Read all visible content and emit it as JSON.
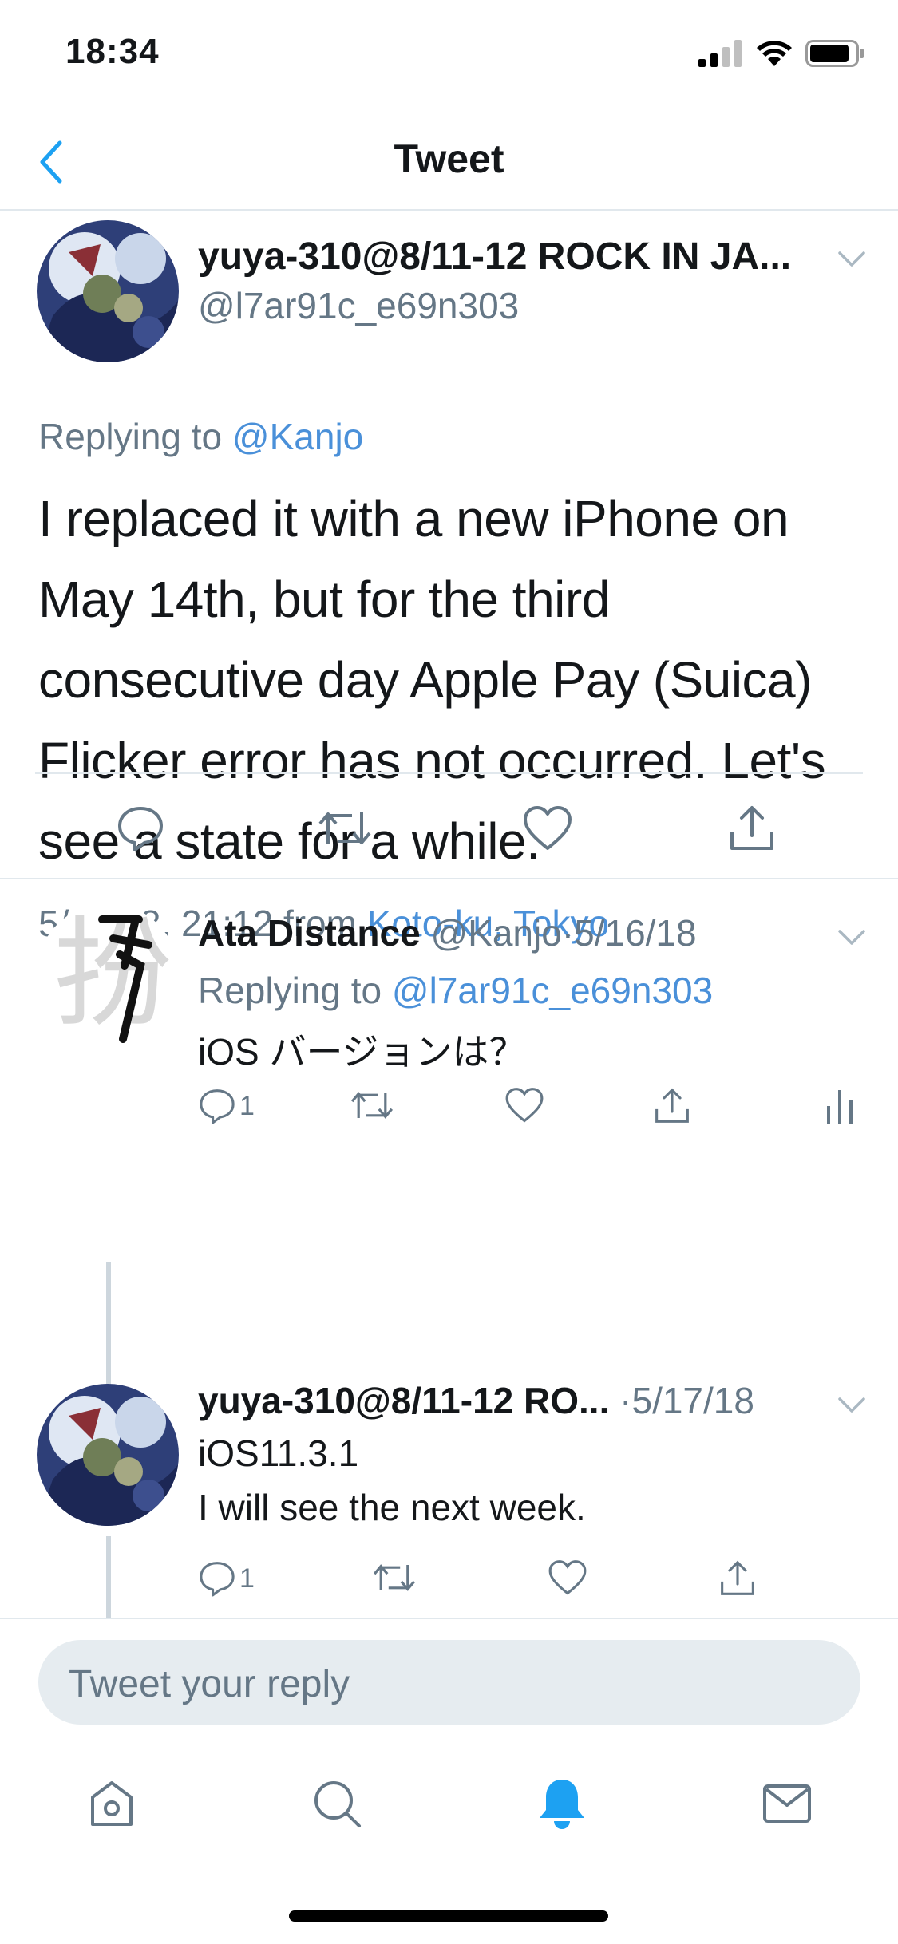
{
  "status_bar": {
    "time": "18:34"
  },
  "nav": {
    "title": "Tweet"
  },
  "main_tweet": {
    "name": "yuya-310@8/11-12 ROCK IN JA...",
    "handle": "@l7ar91c_e69n303",
    "replying_prefix": "Replying to",
    "replying_handle": "@Kanjo",
    "text_lines": [
      "I replaced it with a new iPhone on",
      "May 14th, but for the third",
      "consecutive day Apple Pay (Suica)",
      "Flicker error has not occurred. Let's",
      "see a state for a while."
    ],
    "datetime": "5/16/18, 21:12",
    "from_prefix": "from",
    "location": "Koto-ku, Tokyo"
  },
  "replies": [
    {
      "name": "Ata Distance",
      "handle": "@Kanjo",
      "separator": "·",
      "date": "5/16/18",
      "replying_prefix": "Replying to",
      "replying_handle": "@l7ar91c_e69n303",
      "text_lines": [
        "iOS バージョンは？"
      ],
      "reply_count": "1"
    },
    {
      "name": "yuya-310@8/11-12 RO...",
      "separator": "·",
      "date": "5/17/18",
      "text_lines": [
        "iOS11.3.1",
        "I will see the next week."
      ],
      "reply_count": "1"
    }
  ],
  "compose": {
    "placeholder": "Tweet your reply"
  },
  "tabs": [
    "home-icon",
    "search-icon",
    "notifications-icon",
    "messages-icon"
  ],
  "colors": {
    "accent": "#1da1f2",
    "link": "#4a90d9",
    "muted": "#657786",
    "divider": "#e1e8ed"
  }
}
